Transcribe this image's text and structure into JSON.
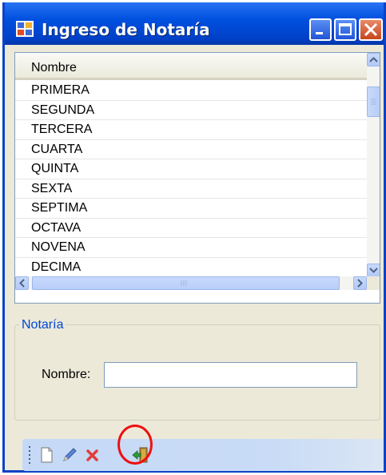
{
  "window": {
    "title": "Ingreso de Notaría"
  },
  "grid": {
    "column_header": "Nombre",
    "rows": [
      "PRIMERA",
      "SEGUNDA",
      "TERCERA",
      "CUARTA",
      "QUINTA",
      "SEXTA",
      "SEPTIMA",
      "OCTAVA",
      "NOVENA",
      "DECIMA"
    ]
  },
  "form": {
    "group_title": "Notaría",
    "nombre_label": "Nombre:",
    "nombre_value": "",
    "nombre_placeholder": ""
  },
  "toolbar": {
    "buttons": [
      "new-icon",
      "edit-icon",
      "delete-icon",
      "exit-icon"
    ],
    "highlighted": "exit-icon"
  },
  "colors": {
    "titlebar": "#0050e0",
    "group_title": "#0046d5",
    "highlight": "#e11111",
    "toolbar_bg": "#c5d9f7"
  }
}
